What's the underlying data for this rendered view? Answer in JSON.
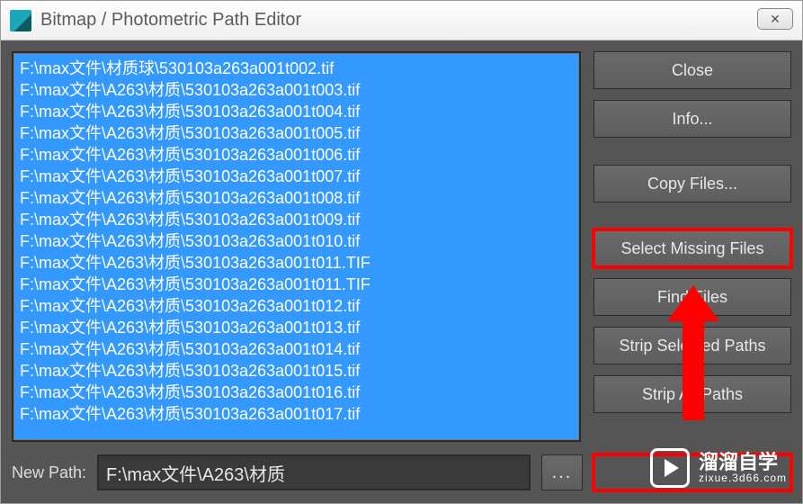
{
  "window": {
    "title": "Bitmap / Photometric Path Editor"
  },
  "sidebar": {
    "close": "Close",
    "info": "Info...",
    "copy_files": "Copy Files...",
    "select_missing": "Select Missing Files",
    "find_files": "Find Files",
    "strip_selected": "Strip Selected Paths",
    "strip_all": "Strip All Paths"
  },
  "footer": {
    "label": "New Path:",
    "path": "F:\\max文件\\A263\\材质",
    "browse": "..."
  },
  "file_list": [
    "F:\\max文件\\材质球\\530103a263a001t002.tif",
    "F:\\max文件\\A263\\材质\\530103a263a001t003.tif",
    "F:\\max文件\\A263\\材质\\530103a263a001t004.tif",
    "F:\\max文件\\A263\\材质\\530103a263a001t005.tif",
    "F:\\max文件\\A263\\材质\\530103a263a001t006.tif",
    "F:\\max文件\\A263\\材质\\530103a263a001t007.tif",
    "F:\\max文件\\A263\\材质\\530103a263a001t008.tif",
    "F:\\max文件\\A263\\材质\\530103a263a001t009.tif",
    "F:\\max文件\\A263\\材质\\530103a263a001t010.tif",
    "F:\\max文件\\A263\\材质\\530103a263a001t011.TIF",
    "F:\\max文件\\A263\\材质\\530103a263a001t011.TIF",
    "F:\\max文件\\A263\\材质\\530103a263a001t012.tif",
    "F:\\max文件\\A263\\材质\\530103a263a001t013.tif",
    "F:\\max文件\\A263\\材质\\530103a263a001t014.tif",
    "F:\\max文件\\A263\\材质\\530103a263a001t015.tif",
    "F:\\max文件\\A263\\材质\\530103a263a001t016.tif",
    "F:\\max文件\\A263\\材质\\530103a263a001t017.tif"
  ],
  "watermark": {
    "cn": "溜溜自学",
    "en": "zixue.3d66.com"
  }
}
